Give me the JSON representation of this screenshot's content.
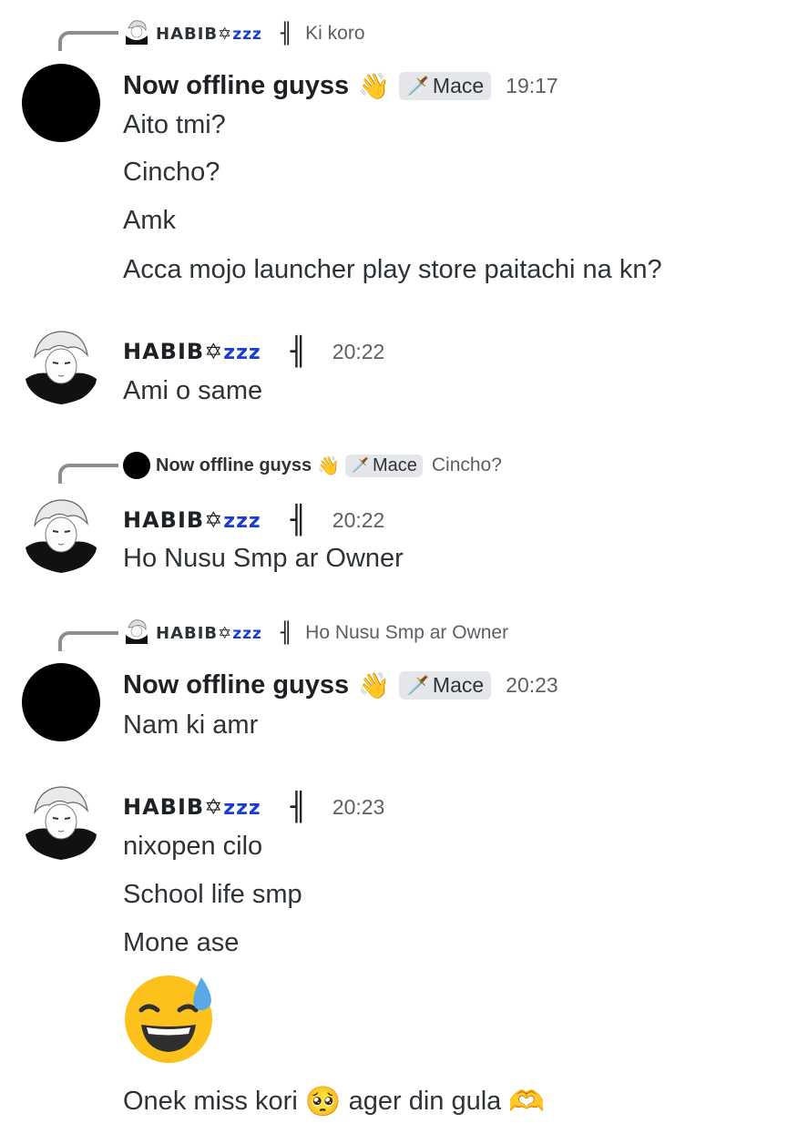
{
  "users": {
    "offline_name": "Now offline guyss",
    "habib_name": "HABIB",
    "habib_zzz": "zzz",
    "role_badge": "Mace",
    "wave_emoji": "👋",
    "sword_emoji": "🗡️",
    "bars_glyph": "╢"
  },
  "messages": [
    {
      "reply": {
        "name": "HABIB",
        "zzz": "zzz",
        "text": "Ki koro"
      },
      "time": "19:17",
      "lines": [
        "Aito tmi?",
        "Cincho?",
        "Amk",
        "Acca mojo launcher play store paitachi na kn?"
      ]
    },
    {
      "time": "20:22",
      "lines": [
        "Ami o same"
      ]
    },
    {
      "reply": {
        "name": "Now offline guyss",
        "badge": "Mace",
        "text": "Cincho?"
      },
      "time": "20:22",
      "lines": [
        "Ho Nusu Smp ar Owner"
      ]
    },
    {
      "reply": {
        "name": "HABIB",
        "zzz": "zzz",
        "text": "Ho Nusu Smp ar Owner"
      },
      "time": "20:23",
      "lines": [
        "Nam ki amr"
      ]
    },
    {
      "time": "20:23",
      "lines": [
        "nixopen cilo",
        "School life smp",
        "Mone ase"
      ],
      "big_emoji": "grinning-sweat-emoji",
      "last_line": {
        "part1": "Onek miss kori",
        "emoji1": "🥺",
        "part2": "ager din gula",
        "emoji2": "🫶"
      }
    }
  ],
  "colors": {
    "badge_bg": "#e4e6e9",
    "zzz": "#1a3dd6",
    "reply_line": "#8a8e93"
  }
}
